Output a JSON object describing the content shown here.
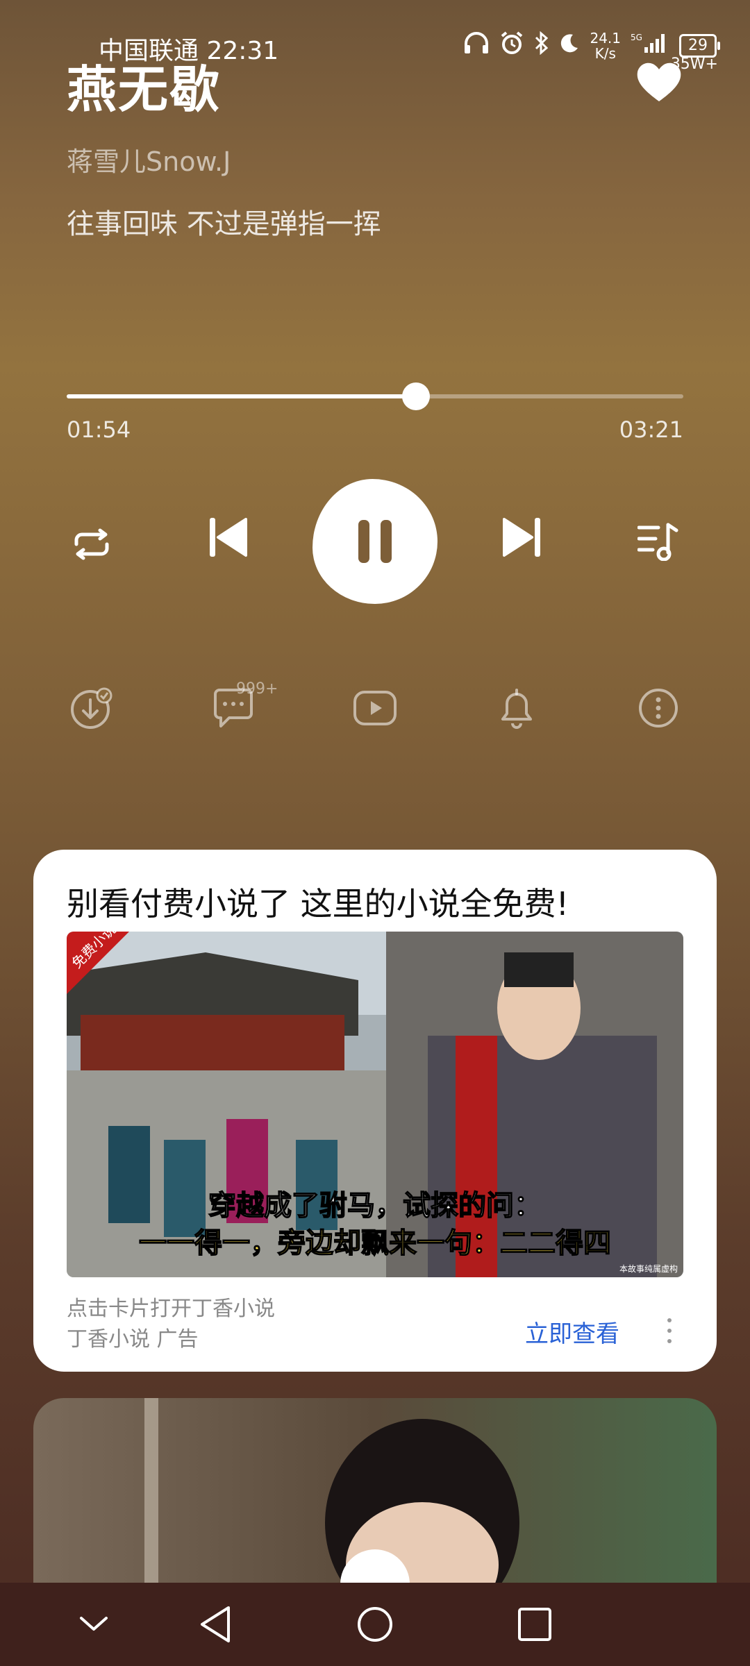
{
  "status_bar": {
    "carrier": "中国联通",
    "time": "22:31",
    "network_speed": "24.1",
    "network_speed_unit": "K/s",
    "network_type": "5G",
    "battery_level": "29",
    "charging": "35W+",
    "icons": [
      "headphones-icon",
      "alarm-icon",
      "bluetooth-icon",
      "moon-icon",
      "signal-icon"
    ]
  },
  "song": {
    "title": "燕无歇",
    "artist": "蒋雪儿Snow.J",
    "lyric": "往事回味 不过是弹指一挥"
  },
  "player": {
    "current_time": "01:54",
    "total_time": "03:21",
    "progress": 0.567,
    "state": "playing"
  },
  "secondary": {
    "comment_count": "999+"
  },
  "ad": {
    "title": "别看付费小说了 这里的小说全免费!",
    "image_badge": "免费小说",
    "image_caption_line1": "穿越成了驸马，试探的问：",
    "image_caption_line2": "一一得一，旁边却飘来一句：二二得四",
    "image_note": "本故事纯属虚构",
    "subtitle": "点击卡片打开丁香小说",
    "source": "丁香小说 广告",
    "cta": "立即查看"
  },
  "colors": {
    "accent_link": "#2a62d6",
    "background_top": "#6e5438",
    "background_bottom": "#4a2a22"
  }
}
